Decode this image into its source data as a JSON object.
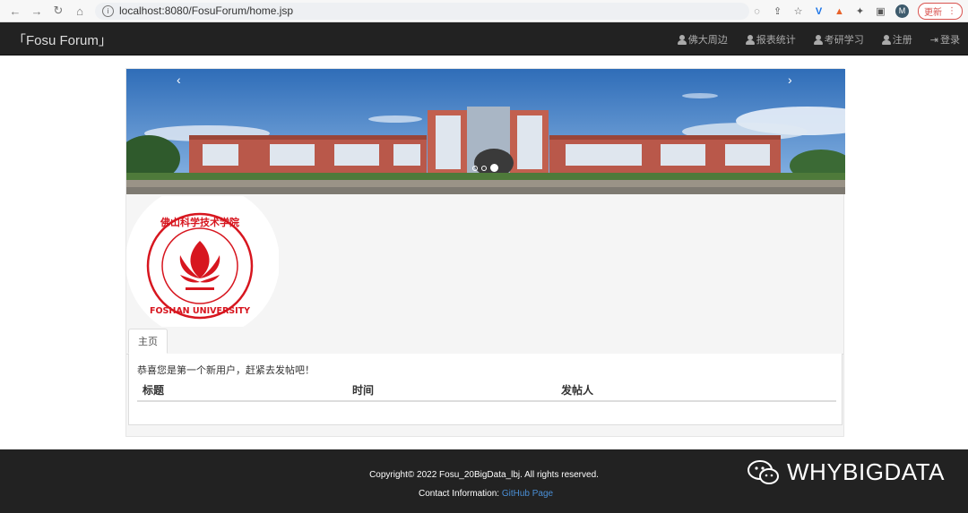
{
  "browser": {
    "url": "localhost:8080/FosuForum/home.jsp",
    "update_label": "更新",
    "avatar_letter": "M"
  },
  "navbar": {
    "brand": "「Fosu Forum」",
    "links": [
      "佛大周边",
      "报表统计",
      "考研学习",
      "注册",
      "登录"
    ]
  },
  "carousel": {
    "prev": "‹",
    "next": "›",
    "indicator_count": 3,
    "active_index": 2
  },
  "logo": {
    "text_top": "佛山科学技术学院",
    "text_bottom": "FOSHAN UNIVERSITY",
    "color": "#d7161f"
  },
  "tabs": [
    "主页"
  ],
  "content": {
    "welcome": "恭喜您是第一个新用户，赶紧去发帖吧！",
    "columns": [
      "标题",
      "时间",
      "发帖人"
    ]
  },
  "footer": {
    "copyright": "Copyright© 2022 Fosu_20BigData_lbj. All rights reserved.",
    "contact_label": "Contact Information:",
    "contact_link": "GitHub Page"
  },
  "watermark": "WHYBIGDATA",
  "colors": {
    "navbar": "#222222",
    "link": "#4a8fd6",
    "logo_red": "#d7161f"
  }
}
